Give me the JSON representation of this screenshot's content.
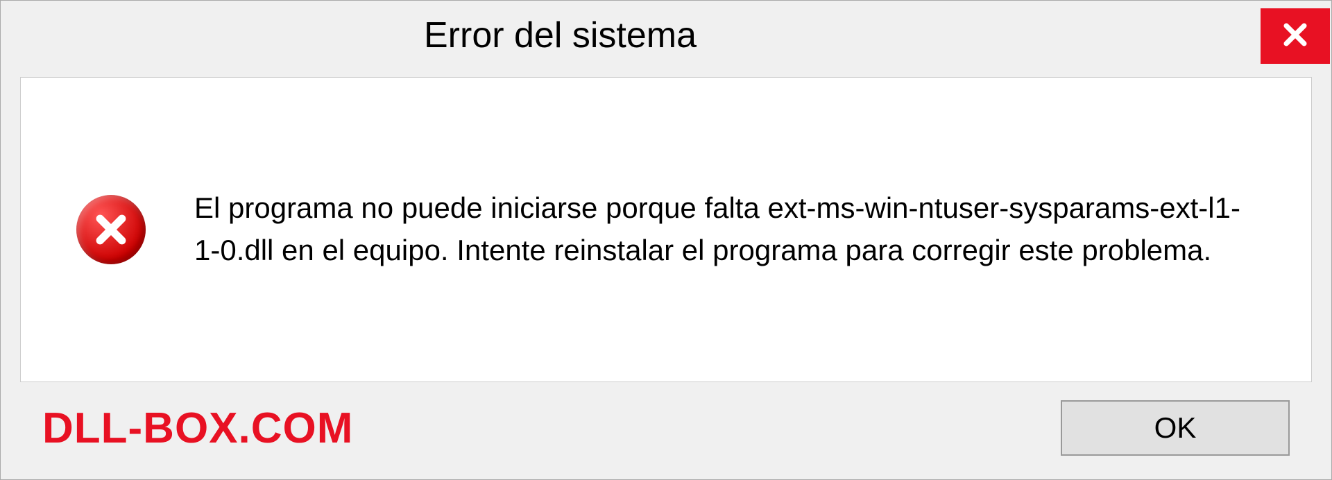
{
  "titlebar": {
    "title": "Error del sistema"
  },
  "message": {
    "text": "El programa no puede iniciarse porque falta ext-ms-win-ntuser-sysparams-ext-l1-1-0.dll en el equipo. Intente reinstalar el programa para corregir este problema."
  },
  "footer": {
    "watermark": "DLL-BOX.COM",
    "ok_label": "OK"
  }
}
